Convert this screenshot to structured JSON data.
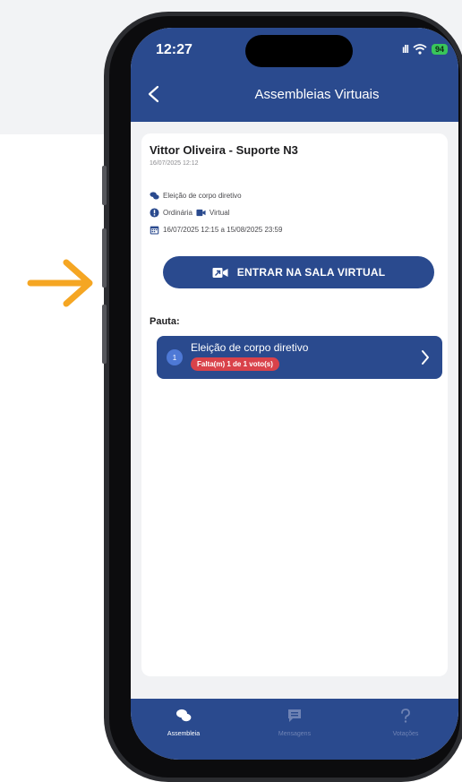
{
  "status": {
    "time": "12:27",
    "battery": "94"
  },
  "header": {
    "title": "Assembleias Virtuais"
  },
  "assembly": {
    "author": "Vittor Oliveira - Suporte N3",
    "created_at": "16/07/2025 12:12",
    "subject": "Eleição de corpo diretivo",
    "type": "Ordinária",
    "mode": "Virtual",
    "period": "16/07/2025 12:15 a 15/08/2025 23:59",
    "enter_button": "ENTRAR NA SALA VIRTUAL"
  },
  "agenda": {
    "heading": "Pauta:",
    "items": [
      {
        "number": "1",
        "title": "Eleição de corpo diretivo",
        "status": "Falta(m) 1 de 1 voto(s)"
      }
    ]
  },
  "tabs": [
    {
      "label": "Assembleia",
      "icon": "chat-bubbles-icon",
      "active": true
    },
    {
      "label": "Mensagens",
      "icon": "message-icon",
      "active": false
    },
    {
      "label": "Votações",
      "icon": "question-icon",
      "active": false
    }
  ],
  "colors": {
    "primary": "#2a4a8e",
    "accent_arrow": "#f5a623",
    "badge": "#d9424a",
    "battery": "#39c65a"
  }
}
